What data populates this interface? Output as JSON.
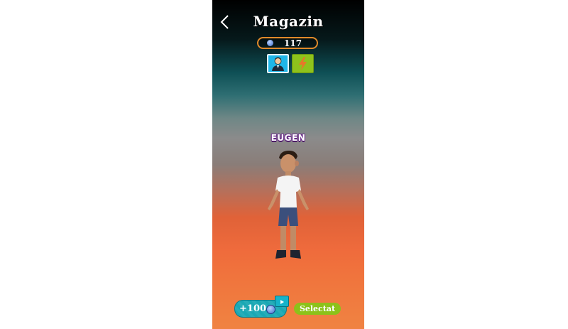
{
  "header": {
    "title": "Magazin",
    "back_icon": "chevron-left-icon"
  },
  "currency": {
    "coin_icon": "coin-icon",
    "count": "117"
  },
  "tabs": [
    {
      "name": "characters",
      "icon": "person-icon",
      "color": "#1fb6e8",
      "selected": true
    },
    {
      "name": "powerups",
      "icon": "lightning-icon",
      "color": "#8ec21c",
      "selected": false
    }
  ],
  "character": {
    "name": "EUGEN"
  },
  "actions": {
    "watch_reward": "+100",
    "watch_icon": "play-video-icon",
    "select_label": "Selectat"
  },
  "colors": {
    "accent_orange": "#e08a2a",
    "button_teal": "#1aa8b4",
    "button_green": "#8cc21a",
    "name_outline": "#6b2d8a"
  }
}
